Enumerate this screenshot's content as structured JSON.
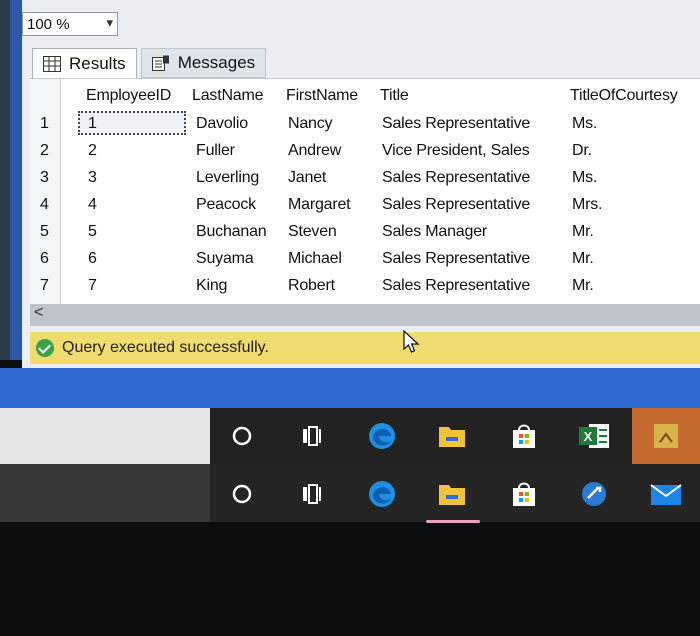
{
  "zoom": {
    "value": "100 %",
    "arrow": "▾"
  },
  "tabs": [
    {
      "label": "Results"
    },
    {
      "label": "Messages"
    }
  ],
  "grid": {
    "columns": [
      "EmployeeID",
      "LastName",
      "FirstName",
      "Title",
      "TitleOfCourtesy"
    ],
    "rows": [
      {
        "n": "1",
        "id": "1",
        "last": "Davolio",
        "first": "Nancy",
        "title": "Sales Representative",
        "toc": "Ms."
      },
      {
        "n": "2",
        "id": "2",
        "last": "Fuller",
        "first": "Andrew",
        "title": "Vice President, Sales",
        "toc": "Dr."
      },
      {
        "n": "3",
        "id": "3",
        "last": "Leverling",
        "first": "Janet",
        "title": "Sales Representative",
        "toc": "Ms."
      },
      {
        "n": "4",
        "id": "4",
        "last": "Peacock",
        "first": "Margaret",
        "title": "Sales Representative",
        "toc": "Mrs."
      },
      {
        "n": "5",
        "id": "5",
        "last": "Buchanan",
        "first": "Steven",
        "title": "Sales Manager",
        "toc": "Mr."
      },
      {
        "n": "6",
        "id": "6",
        "last": "Suyama",
        "first": "Michael",
        "title": "Sales Representative",
        "toc": "Mr."
      },
      {
        "n": "7",
        "id": "7",
        "last": "King",
        "first": "Robert",
        "title": "Sales Representative",
        "toc": "Mr."
      }
    ]
  },
  "scroll": {
    "left_arrow": "<"
  },
  "status": {
    "text": "Query executed successfully."
  },
  "taskbar": {
    "icons": [
      "cortana-icon",
      "task-view-icon",
      "edge-icon",
      "file-explorer-icon",
      "store-icon",
      "excel-icon",
      "app-tile-icon"
    ],
    "excel_label": "X",
    "colors": {
      "accent_blue": "#2e6bd3",
      "status_yellow": "#f0db6e",
      "excel_green": "#1f7a3a"
    }
  }
}
